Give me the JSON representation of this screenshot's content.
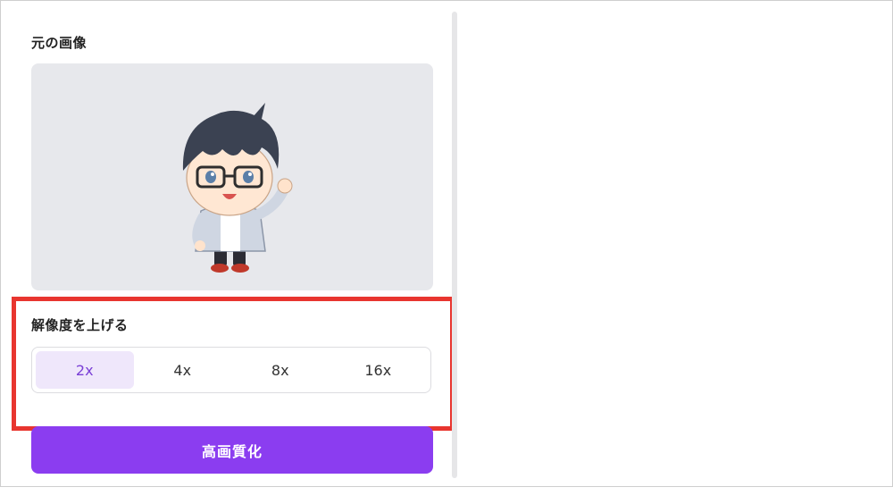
{
  "original_image": {
    "title": "元の画像",
    "alt": "chibi character with glasses waving"
  },
  "upscale": {
    "title": "解像度を上げる",
    "options": [
      "2x",
      "4x",
      "8x",
      "16x"
    ],
    "selected": "2x"
  },
  "actions": {
    "enhance_label": "高画質化"
  },
  "colors": {
    "accent": "#8b3df0",
    "highlight": "#e8352f",
    "active_bg": "#efe7fb"
  }
}
